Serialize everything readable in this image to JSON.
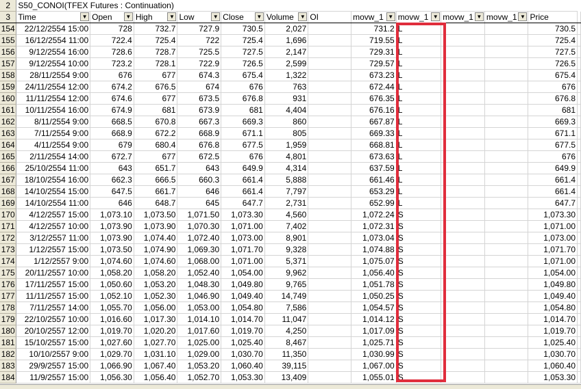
{
  "title": "S50_CONOI(TFEX Futures : Continuation)",
  "title_row_number": "2",
  "header_row_number": "3",
  "headers": [
    "Time",
    "Open",
    "High",
    "Low",
    "Close",
    "Volume",
    "OI",
    "movw_1",
    "movw_1",
    "movw_1",
    "movw_1",
    "Price"
  ],
  "rows": [
    [
      "154",
      "22/12/2554 15:00",
      "728",
      "732.7",
      "727.9",
      "730.5",
      "2,027",
      "731.2",
      "L",
      "730.5"
    ],
    [
      "155",
      "16/12/2554 11:00",
      "722.4",
      "725.4",
      "722",
      "725.4",
      "1,696",
      "719.55",
      "L",
      "725.4"
    ],
    [
      "156",
      "9/12/2554 16:00",
      "728.6",
      "728.7",
      "725.5",
      "727.5",
      "2,147",
      "729.31",
      "L",
      "727.5"
    ],
    [
      "157",
      "9/12/2554 10:00",
      "723.2",
      "728.1",
      "722.9",
      "726.5",
      "2,599",
      "729.57",
      "L",
      "726.5"
    ],
    [
      "158",
      "28/11/2554 9:00",
      "676",
      "677",
      "674.3",
      "675.4",
      "1,322",
      "673.23",
      "L",
      "675.4"
    ],
    [
      "159",
      "24/11/2554 12:00",
      "674.2",
      "676.5",
      "674",
      "676",
      "763",
      "672.44",
      "L",
      "676"
    ],
    [
      "160",
      "11/11/2554 12:00",
      "674.6",
      "677",
      "673.5",
      "676.8",
      "931",
      "676.35",
      "L",
      "676.8"
    ],
    [
      "161",
      "10/11/2554 16:00",
      "674.9",
      "681",
      "673.9",
      "681",
      "4,404",
      "676.16",
      "L",
      "681"
    ],
    [
      "162",
      "8/11/2554 9:00",
      "668.5",
      "670.8",
      "667.3",
      "669.3",
      "860",
      "667.87",
      "L",
      "669.3"
    ],
    [
      "163",
      "7/11/2554 9:00",
      "668.9",
      "672.2",
      "668.9",
      "671.1",
      "805",
      "669.33",
      "L",
      "671.1"
    ],
    [
      "164",
      "4/11/2554 9:00",
      "679",
      "680.4",
      "676.8",
      "677.5",
      "1,959",
      "668.81",
      "L",
      "677.5"
    ],
    [
      "165",
      "2/11/2554 14:00",
      "672.7",
      "677",
      "672.5",
      "676",
      "4,801",
      "673.63",
      "L",
      "676"
    ],
    [
      "166",
      "25/10/2554 11:00",
      "643",
      "651.7",
      "643",
      "649.9",
      "4,314",
      "637.59",
      "L",
      "649.9"
    ],
    [
      "167",
      "18/10/2554 16:00",
      "662.3",
      "666.5",
      "660.3",
      "661.4",
      "5,888",
      "661.46",
      "L",
      "661.4"
    ],
    [
      "168",
      "14/10/2554 15:00",
      "647.5",
      "661.7",
      "646",
      "661.4",
      "7,797",
      "653.29",
      "L",
      "661.4"
    ],
    [
      "169",
      "14/10/2554 11:00",
      "646",
      "648.7",
      "645",
      "647.7",
      "2,731",
      "652.99",
      "L",
      "647.7"
    ],
    [
      "170",
      "4/12/2557 15:00",
      "1,073.10",
      "1,073.50",
      "1,071.50",
      "1,073.30",
      "4,560",
      "1,072.24",
      "S",
      "1,073.30"
    ],
    [
      "171",
      "4/12/2557 10:00",
      "1,073.90",
      "1,073.90",
      "1,070.30",
      "1,071.00",
      "7,402",
      "1,072.31",
      "S",
      "1,071.00"
    ],
    [
      "172",
      "3/12/2557 11:00",
      "1,073.90",
      "1,074.40",
      "1,072.40",
      "1,073.00",
      "8,901",
      "1,073.04",
      "S",
      "1,073.00"
    ],
    [
      "173",
      "1/12/2557 15:00",
      "1,073.50",
      "1,074.90",
      "1,069.30",
      "1,071.70",
      "9,328",
      "1,074.88",
      "S",
      "1,071.70"
    ],
    [
      "174",
      "1/12/2557 9:00",
      "1,074.60",
      "1,074.60",
      "1,068.00",
      "1,071.00",
      "5,371",
      "1,075.07",
      "S",
      "1,071.00"
    ],
    [
      "175",
      "20/11/2557 10:00",
      "1,058.20",
      "1,058.20",
      "1,052.40",
      "1,054.00",
      "9,962",
      "1,056.40",
      "S",
      "1,054.00"
    ],
    [
      "176",
      "17/11/2557 15:00",
      "1,050.60",
      "1,053.20",
      "1,048.30",
      "1,049.80",
      "9,765",
      "1,051.78",
      "S",
      "1,049.80"
    ],
    [
      "177",
      "11/11/2557 15:00",
      "1,052.10",
      "1,052.30",
      "1,046.90",
      "1,049.40",
      "14,749",
      "1,050.25",
      "S",
      "1,049.40"
    ],
    [
      "178",
      "7/11/2557 14:00",
      "1,055.70",
      "1,056.00",
      "1,053.00",
      "1,054.80",
      "7,586",
      "1,054.57",
      "S",
      "1,054.80"
    ],
    [
      "179",
      "22/10/2557 10:00",
      "1,016.60",
      "1,017.30",
      "1,014.10",
      "1,014.70",
      "11,047",
      "1,014.12",
      "S",
      "1,014.70"
    ],
    [
      "180",
      "20/10/2557 12:00",
      "1,019.70",
      "1,020.20",
      "1,017.60",
      "1,019.70",
      "4,250",
      "1,017.09",
      "S",
      "1,019.70"
    ],
    [
      "181",
      "15/10/2557 15:00",
      "1,027.60",
      "1,027.70",
      "1,025.00",
      "1,025.40",
      "8,467",
      "1,025.71",
      "S",
      "1,025.40"
    ],
    [
      "182",
      "10/10/2557 9:00",
      "1,029.70",
      "1,031.10",
      "1,029.00",
      "1,030.70",
      "11,350",
      "1,030.99",
      "S",
      "1,030.70"
    ],
    [
      "183",
      "29/9/2557 15:00",
      "1,066.90",
      "1,067.40",
      "1,053.20",
      "1,060.40",
      "39,115",
      "1,067.00",
      "S",
      "1,060.40"
    ],
    [
      "184",
      "11/9/2557 15:00",
      "1,056.30",
      "1,056.40",
      "1,052.70",
      "1,053.30",
      "13,409",
      "1,055.01",
      "S",
      "1,053.30"
    ]
  ],
  "highlight_color": "#e02d3c"
}
